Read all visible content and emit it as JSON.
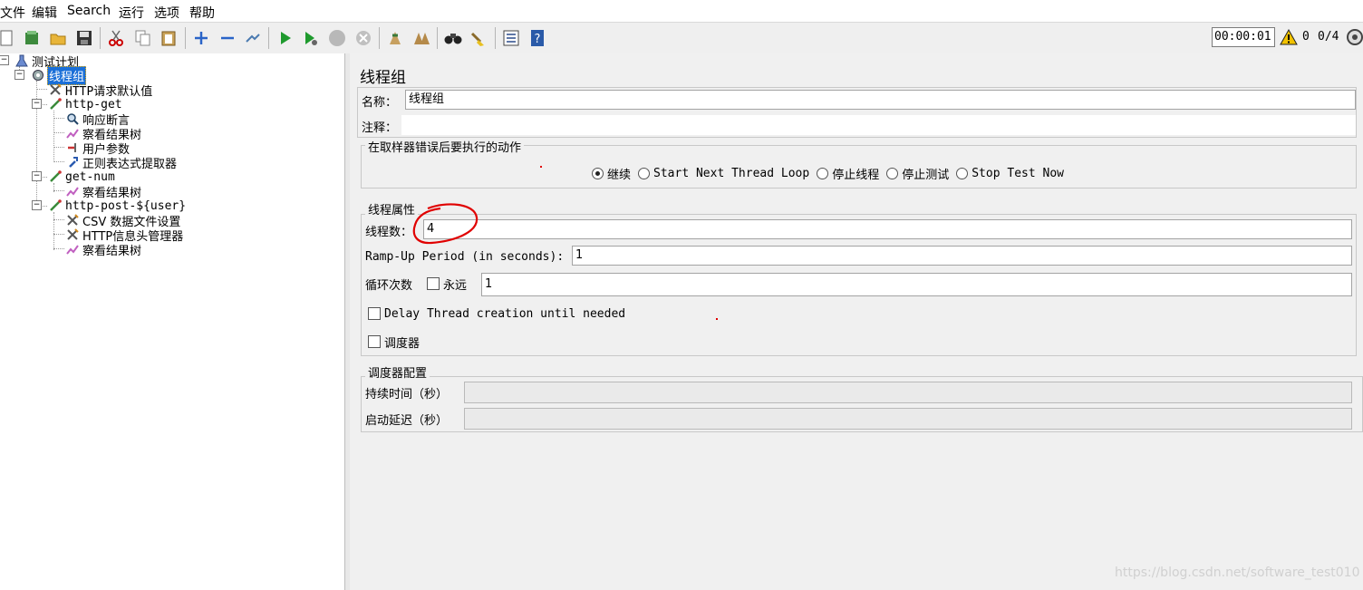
{
  "menu": [
    "文件",
    "编辑",
    "Search",
    "运行",
    "选项",
    "帮助"
  ],
  "toolbar": {
    "icons": [
      "new-icon",
      "templates-icon",
      "open-icon",
      "save-icon",
      "cut-icon",
      "copy-icon",
      "paste-icon",
      "expand-icon",
      "collapse-icon",
      "toggle-icon",
      "start-icon",
      "start-no-pause-icon",
      "stop-icon",
      "shutdown-icon",
      "clear-icon",
      "clear-all-icon",
      "search-icon",
      "reset-search-icon",
      "function-helper-icon",
      "help-icon"
    ],
    "timer": "00:00:01",
    "error_count": "0",
    "threads": "0/4"
  },
  "tree": {
    "items": [
      {
        "label": "测试计划",
        "icon": "test-plan-icon"
      },
      {
        "label": "线程组",
        "icon": "thread-group-icon"
      },
      {
        "label": "HTTP请求默认值",
        "icon": "config-element-icon"
      },
      {
        "label": "http-get",
        "icon": "sampler-icon"
      },
      {
        "label": "响应断言",
        "icon": "assertion-icon"
      },
      {
        "label": "察看结果树",
        "icon": "listener-icon"
      },
      {
        "label": "用户参数",
        "icon": "preprocessor-icon"
      },
      {
        "label": "正则表达式提取器",
        "icon": "postprocessor-icon"
      },
      {
        "label": "get-num",
        "icon": "sampler-icon"
      },
      {
        "label": "察看结果树",
        "icon": "listener-icon"
      },
      {
        "label": "http-post-${user}",
        "icon": "sampler-icon"
      },
      {
        "label": "CSV 数据文件设置",
        "icon": "config-element-icon"
      },
      {
        "label": "HTTP信息头管理器",
        "icon": "config-element-icon"
      },
      {
        "label": "察看结果树",
        "icon": "listener-icon"
      }
    ]
  },
  "panel": {
    "title": "线程组",
    "name_label": "名称：",
    "name_value": "线程组",
    "comment_label": "注释：",
    "comment_value": "",
    "error_action": {
      "legend": "在取样器错误后要执行的动作",
      "options": [
        "继续",
        "Start Next Thread Loop",
        "停止线程",
        "停止测试",
        "Stop Test Now"
      ],
      "selected": "继续"
    },
    "thread_props": {
      "legend": "线程属性",
      "threads_label": "线程数：",
      "threads_value": "4",
      "rampup_label": "Ramp-Up Period (in seconds):",
      "rampup_value": "1",
      "loop_label": "循环次数",
      "forever_label": "永远",
      "loop_value": "1",
      "delay_label": "Delay Thread creation until needed",
      "scheduler_label": "调度器"
    },
    "scheduler": {
      "legend": "调度器配置",
      "duration_label": "持续时间（秒）",
      "delay_label": "启动延迟（秒）"
    }
  },
  "watermark": "https://blog.csdn.net/software_test010",
  "colors": {
    "selection": "#1a6fd8",
    "annotation": "#e00000",
    "panel_bg": "#f0f0f0"
  }
}
